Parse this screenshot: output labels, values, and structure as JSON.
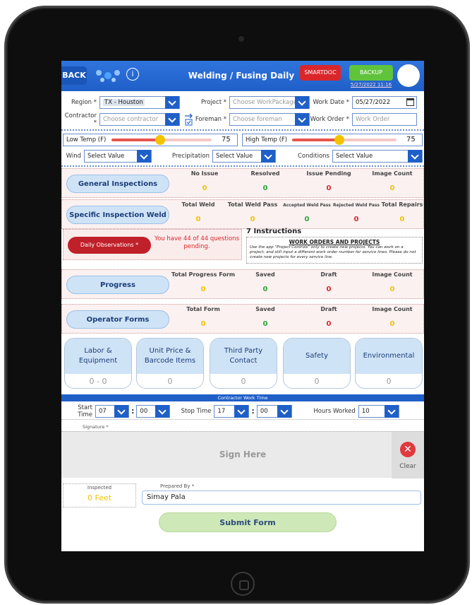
{
  "header": {
    "back_label": "BACK",
    "title": "Welding / Fusing Daily",
    "smartdoc_label": "SMARTDOC",
    "backup_label": "BACKUP",
    "backup_date": "5/27/2022 11:16"
  },
  "form": {
    "region_label": "Region *",
    "region_value": "TX - Houston",
    "project_label": "Project *",
    "project_placeholder": "Choose WorkPackage",
    "work_date_label": "Work Date *",
    "work_date_value": "05/27/2022",
    "contractor_label": "Contractor *",
    "contractor_placeholder": "Choose contractor",
    "foreman_label": "Foreman *",
    "foreman_placeholder": "Choose foreman",
    "work_order_label": "Work Order *",
    "work_order_placeholder": "Work Order",
    "low_temp_label": "Low Temp (F)",
    "low_temp_value": "75",
    "high_temp_label": "High Temp (F)",
    "high_temp_value": "75",
    "wind_label": "Wind",
    "wind_value": "Select Value",
    "precip_label": "Precipitation",
    "precip_value": "Select Value",
    "conditions_label": "Conditions",
    "conditions_value": "Select Value"
  },
  "general": {
    "label": "General Inspections",
    "cols": [
      "No Issue",
      "Resolved",
      "Issue Pending",
      "Image Count"
    ],
    "vals": [
      "0",
      "0",
      "0",
      "0"
    ]
  },
  "specific": {
    "label": "Specific Inspection Weld",
    "cols": [
      "Total Weld",
      "Total Weld Pass",
      "Accepted Weld Pass",
      "Rejected Weld Pass",
      "Total Repairs"
    ],
    "vals": [
      "0",
      "0",
      "0",
      "0",
      "0"
    ]
  },
  "observations": {
    "button": "Daily Observations *",
    "pending_text": "You have 44 of 44  questions pending.",
    "instructions_title": "7 Instructions",
    "notice_title": "WORK ORDERS AND PROJECTS",
    "notice_text": "Use the app \"Project Controls\" only to create new projects. You can work on a project, and still input a different work order number for service lines. Please do not create new projects for every service line."
  },
  "progress": {
    "label": "Progress",
    "cols": [
      "Total Progress Form",
      "Saved",
      "Draft",
      "Image Count"
    ],
    "vals": [
      "0",
      "0",
      "0",
      "0"
    ]
  },
  "operator": {
    "label": "Operator Forms",
    "cols": [
      "Total Form",
      "Saved",
      "Draft",
      "Image Count"
    ],
    "vals": [
      "0",
      "0",
      "0",
      "0"
    ]
  },
  "cards": [
    {
      "title": "Labor & Equipment",
      "value": "0 - 0"
    },
    {
      "title": "Unit Price & Barcode Items",
      "value": "0"
    },
    {
      "title": "Third Party Contact",
      "value": "0"
    },
    {
      "title": "Safety",
      "value": "0"
    },
    {
      "title": "Environmental",
      "value": "0"
    }
  ],
  "work_time": {
    "title": "Contractor Work Time",
    "start_label": "Start Time",
    "start_hour": "07",
    "start_min": "00",
    "stop_label": "Stop Time",
    "stop_hour": "17",
    "stop_min": "00",
    "hours_label": "Hours Worked",
    "hours_value": "10"
  },
  "signature": {
    "label": "Signature *",
    "placeholder": "Sign Here",
    "clear_label": "Clear"
  },
  "footer": {
    "inspected_label": "Inspected",
    "inspected_value": "0 Feet",
    "prepared_label": "Prepared By *",
    "prepared_value": "Simay Pala",
    "submit_label": "Submit Form"
  },
  "colors": {
    "primary": "#1f5fc8",
    "danger": "#d9262b",
    "success": "#5fc43c",
    "warning": "#f2c300"
  }
}
